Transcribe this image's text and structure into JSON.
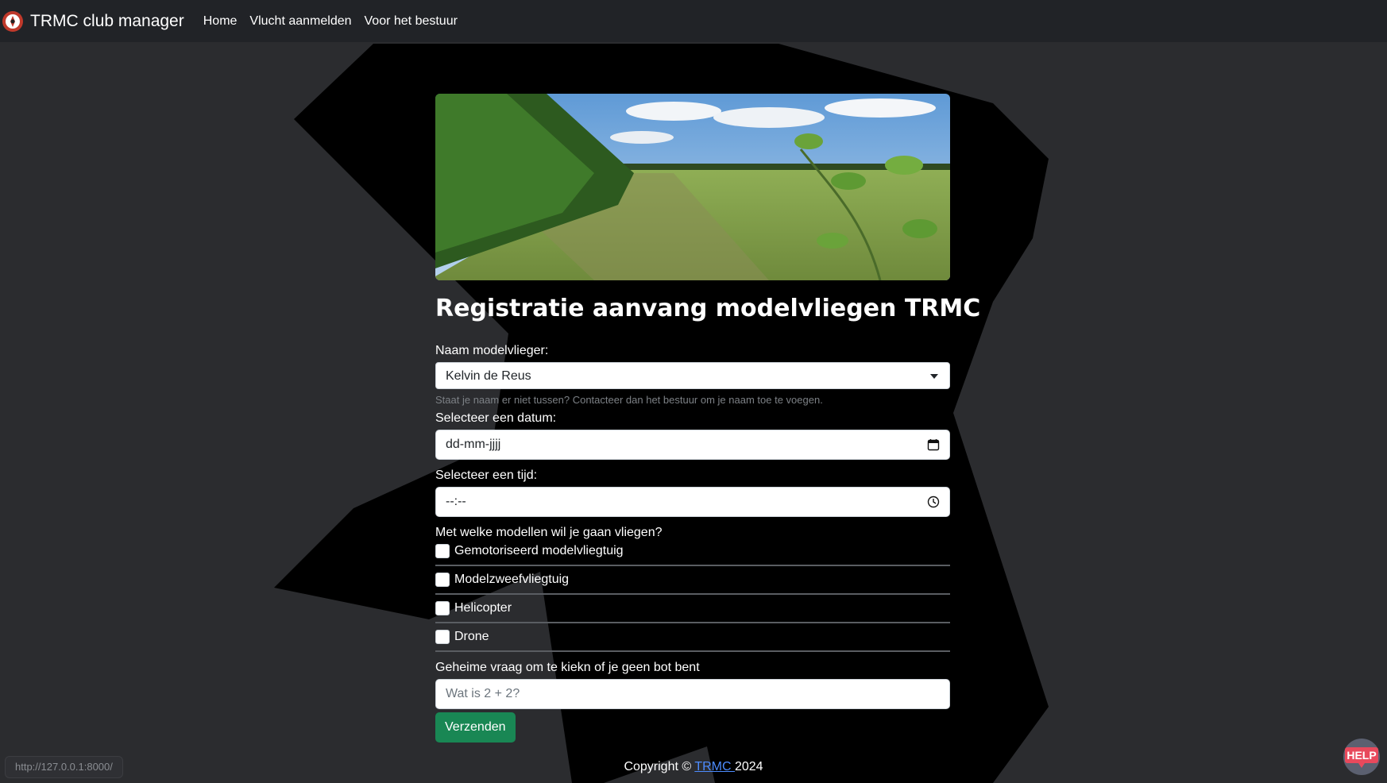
{
  "navbar": {
    "brand": "TRMC club manager",
    "links": [
      "Home",
      "Vlucht aanmelden",
      "Voor het bestuur"
    ]
  },
  "form": {
    "title": "Registratie aanvang modelvliegen TRMC",
    "name_label": "Naam modelvlieger:",
    "name_value": "Kelvin de Reus",
    "name_help": "Staat je naam er niet tussen? Contacteer dan het bestuur om je naam toe te voegen.",
    "date_label": "Selecteer een datum:",
    "date_placeholder": "dd-mm-jjjj",
    "time_label": "Selecteer een tijd:",
    "time_placeholder": "--:--",
    "models_label": "Met welke modellen wil je gaan vliegen?",
    "models": [
      {
        "label": "Gemotoriseerd modelvliegtuig",
        "checked": false
      },
      {
        "label": "Modelzweefvliegtuig",
        "checked": false
      },
      {
        "label": "Helicopter",
        "checked": false
      },
      {
        "label": "Drone",
        "checked": false
      }
    ],
    "captcha_label": "Geheime vraag om te kiekn of je geen bot bent",
    "captcha_placeholder": "Wat is 2 + 2?",
    "submit": "Verzenden"
  },
  "footer": {
    "prefix": "Copyright © ",
    "link": "TRMC ",
    "year": "2024"
  },
  "status_url": "http://127.0.0.1:8000/",
  "help_badge": "HELP",
  "colors": {
    "background": "#2b2c2f",
    "navbar": "#212327",
    "button": "#198754",
    "link": "#4d8cff"
  }
}
